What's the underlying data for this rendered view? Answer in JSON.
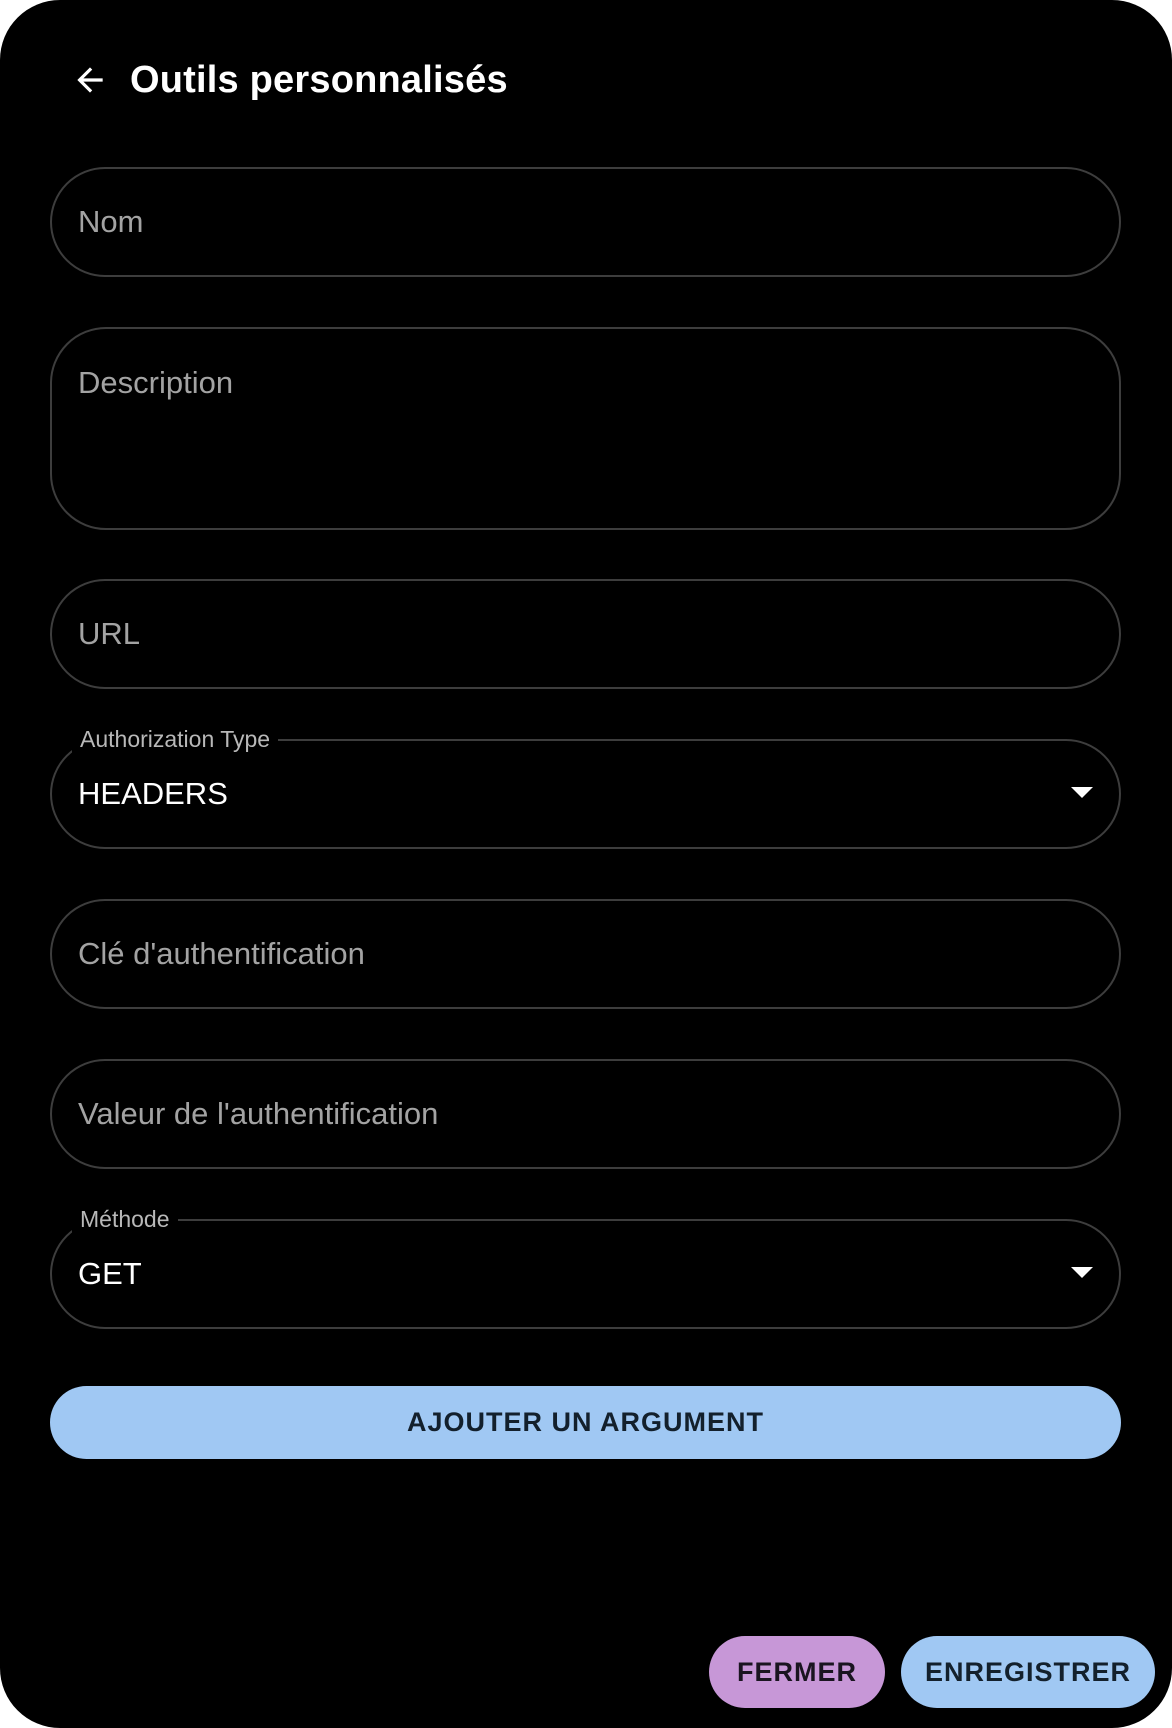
{
  "header": {
    "title": "Outils personnalisés",
    "back_icon": "arrow-left-icon"
  },
  "form": {
    "name": {
      "placeholder": "Nom",
      "value": ""
    },
    "description": {
      "placeholder": "Description",
      "value": ""
    },
    "url": {
      "placeholder": "URL",
      "value": ""
    },
    "authorization_type": {
      "label": "Authorization Type",
      "value": "HEADERS",
      "icon": "caret-down-icon"
    },
    "auth_key": {
      "placeholder": "Clé d'authentification",
      "value": ""
    },
    "auth_value": {
      "placeholder": "Valeur de l'authentification",
      "value": ""
    },
    "method": {
      "label": "Méthode",
      "value": "GET",
      "icon": "caret-down-icon"
    }
  },
  "actions": {
    "add_argument_label": "AJOUTER UN ARGUMENT",
    "close_label": "FERMER",
    "save_label": "ENREGISTRER"
  },
  "colors": {
    "background": "#000000",
    "field_border": "#3d3d3d",
    "primary_button": "#a0c8f3",
    "secondary_button": "#c797d7",
    "text_primary": "#ffffff",
    "text_placeholder": "#a3a3a3"
  }
}
